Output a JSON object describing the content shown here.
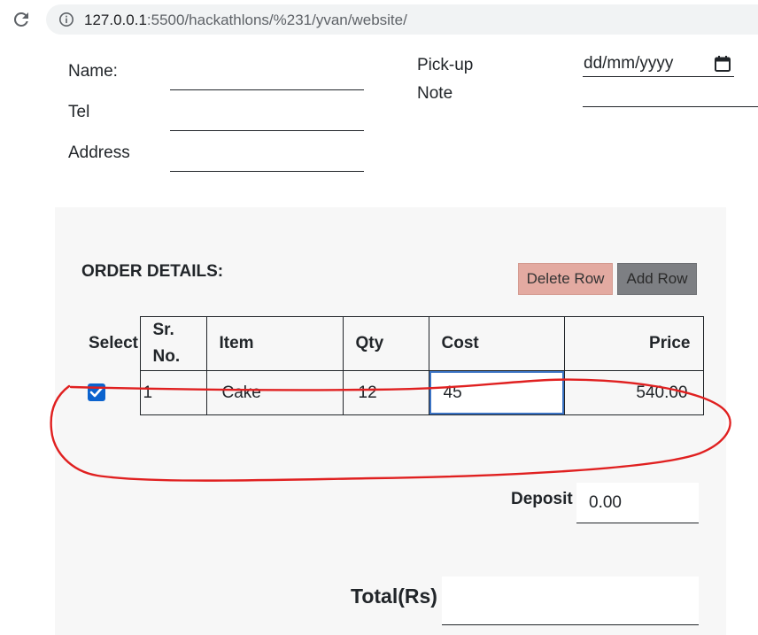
{
  "browser": {
    "url_host": "127.0.0.1",
    "url_path": ":5500/hackathlons/%231/yvan/website/"
  },
  "customer": {
    "name_label": "Name:",
    "name_value": "",
    "tel_label": "Tel",
    "tel_value": "",
    "address_label": "Address",
    "address_value": "",
    "pickup_label": "Pick-up",
    "pickup_date_placeholder": "dd/mm/yyyy",
    "note_label": "Note",
    "note_value": ""
  },
  "order": {
    "title": "ORDER DETAILS:",
    "delete_row_label": "Delete Row",
    "add_row_label": "Add Row",
    "columns": {
      "select": "Select",
      "sr_no_line1": "Sr.",
      "sr_no_line2": "No.",
      "item": "Item",
      "qty": "Qty",
      "cost": "Cost",
      "price": "Price"
    },
    "rows": [
      {
        "selected": true,
        "sr_no": "1",
        "item": "Cake",
        "qty": "12",
        "cost": "45",
        "price": "540.00"
      }
    ],
    "deposit_label": "Deposit",
    "deposit_value": "0.00",
    "total_label": "Total(Rs)",
    "total_value": ""
  },
  "colors": {
    "delete_button_bg": "#e3aaa1",
    "add_button_bg": "#7d7f83",
    "checkbox": "#0b63ce",
    "focus_border": "#3b73c4",
    "annotation_stroke": "#e02020"
  }
}
